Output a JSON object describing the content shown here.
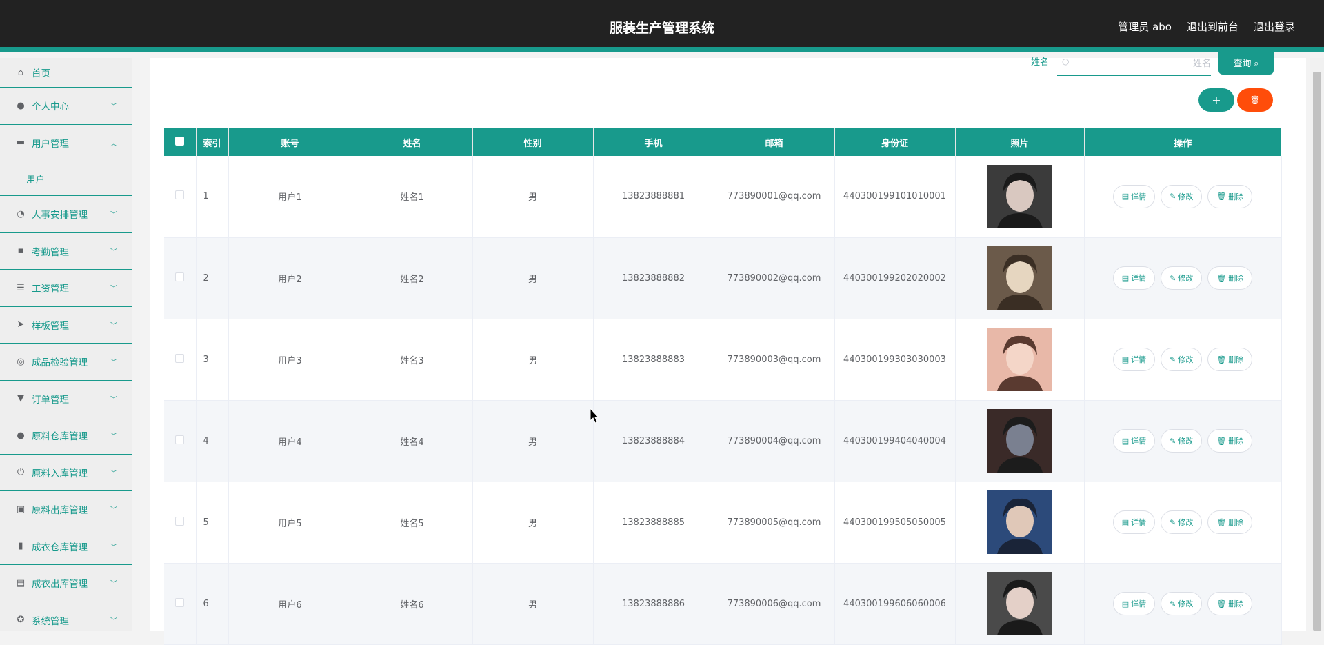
{
  "header": {
    "title": "服装生产管理系统",
    "admin_label": "管理员 abo",
    "back_to_front": "退出到前台",
    "logout": "退出登录"
  },
  "sidebar": {
    "items": [
      {
        "label": "首页",
        "icon": "home-icon"
      },
      {
        "label": "个人中心",
        "icon": "person-icon"
      },
      {
        "label": "用户管理",
        "icon": "users-icon",
        "expanded": true,
        "children": [
          {
            "label": "用户"
          }
        ]
      },
      {
        "label": "人事安排管理",
        "icon": "gauge-icon"
      },
      {
        "label": "考勤管理",
        "icon": "chat-icon"
      },
      {
        "label": "工资管理",
        "icon": "list-icon"
      },
      {
        "label": "样板管理",
        "icon": "send-icon"
      },
      {
        "label": "成品检验管理",
        "icon": "target-icon"
      },
      {
        "label": "订单管理",
        "icon": "stamp-icon"
      },
      {
        "label": "原料仓库管理",
        "icon": "person-icon"
      },
      {
        "label": "原料入库管理",
        "icon": "power-icon"
      },
      {
        "label": "原料出库管理",
        "icon": "box-icon"
      },
      {
        "label": "成衣仓库管理",
        "icon": "chart-icon"
      },
      {
        "label": "成衣出库管理",
        "icon": "clipboard-icon"
      },
      {
        "label": "系统管理",
        "icon": "compass-icon"
      }
    ]
  },
  "search": {
    "label": "姓名",
    "placeholder": "姓名",
    "button": "查询"
  },
  "table": {
    "columns": [
      "索引",
      "账号",
      "姓名",
      "性别",
      "手机",
      "邮箱",
      "身份证",
      "照片",
      "操作"
    ],
    "rows": [
      {
        "index": "1",
        "account": "用户1",
        "name": "姓名1",
        "gender": "男",
        "phone": "13823888881",
        "email": "773890001@qq.com",
        "idcard": "440300199101010001"
      },
      {
        "index": "2",
        "account": "用户2",
        "name": "姓名2",
        "gender": "男",
        "phone": "13823888882",
        "email": "773890002@qq.com",
        "idcard": "440300199202020002"
      },
      {
        "index": "3",
        "account": "用户3",
        "name": "姓名3",
        "gender": "男",
        "phone": "13823888883",
        "email": "773890003@qq.com",
        "idcard": "440300199303030003"
      },
      {
        "index": "4",
        "account": "用户4",
        "name": "姓名4",
        "gender": "男",
        "phone": "13823888884",
        "email": "773890004@qq.com",
        "idcard": "440300199404040004"
      },
      {
        "index": "5",
        "account": "用户5",
        "name": "姓名5",
        "gender": "男",
        "phone": "13823888885",
        "email": "773890005@qq.com",
        "idcard": "440300199505050005"
      },
      {
        "index": "6",
        "account": "用户6",
        "name": "姓名6",
        "gender": "男",
        "phone": "13823888886",
        "email": "773890006@qq.com",
        "idcard": "440300199606060006"
      }
    ],
    "actions": {
      "detail": "详情",
      "edit": "修改",
      "delete": "删除"
    }
  },
  "colors": {
    "accent": "#189a8c",
    "danger": "#ff4d0a",
    "topbar": "#222222"
  }
}
